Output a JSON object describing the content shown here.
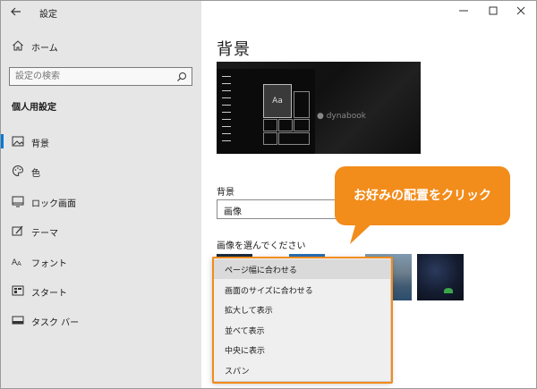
{
  "app": {
    "title": "設定"
  },
  "sidebar": {
    "home_label": "ホーム",
    "search_placeholder": "設定の検索",
    "section_title": "個人用設定",
    "items": [
      {
        "label": "背景",
        "icon": "picture-icon",
        "active": true
      },
      {
        "label": "色",
        "icon": "palette-icon",
        "active": false
      },
      {
        "label": "ロック画面",
        "icon": "lock-screen-icon",
        "active": false
      },
      {
        "label": "テーマ",
        "icon": "theme-icon",
        "active": false
      },
      {
        "label": "フォント",
        "icon": "font-icon",
        "active": false
      },
      {
        "label": "スタート",
        "icon": "start-icon",
        "active": false
      },
      {
        "label": "タスク バー",
        "icon": "taskbar-icon",
        "active": false
      }
    ]
  },
  "main": {
    "title": "背景",
    "preview": {
      "tile_label": "Aa",
      "brand": "dynabook"
    },
    "background_label": "背景",
    "background_value": "画像",
    "choose_label": "画像を選んでください"
  },
  "fit_dropdown": {
    "options": [
      "ページ幅に合わせる",
      "画面のサイズに合わせる",
      "拡大して表示",
      "並べて表示",
      "中央に表示",
      "スパン"
    ],
    "selected_index": 0
  },
  "callout": {
    "text": "お好みの配置をクリック"
  },
  "colors": {
    "sidebar_bg": "#e6e6e6",
    "accent": "#0078d7",
    "callout": "#f28c1b"
  }
}
